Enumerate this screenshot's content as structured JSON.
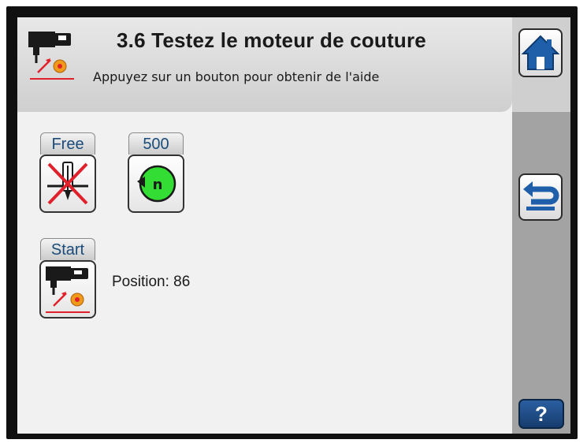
{
  "header": {
    "title": "3.6 Testez le moteur de couture",
    "subtitle": "Appuyez sur un bouton pour obtenir de l'aide",
    "icon": "sewing-motor-icon"
  },
  "sidebar": {
    "home_icon": "home-icon",
    "back_icon": "return-arrow-icon",
    "help_label": "?"
  },
  "tools": [
    {
      "label": "Free",
      "icon": "needle-free-crossed-icon"
    },
    {
      "label": "500",
      "icon": "speed-rotation-icon"
    },
    {
      "label": "Start",
      "icon": "sewing-motor-start-icon"
    }
  ],
  "status": {
    "position_text": "Position: 86"
  },
  "colors": {
    "accent_blue": "#1f5faa",
    "speed_green": "#33dd33",
    "warning_red": "#e0202a",
    "motor_orange": "#f09a1a"
  }
}
